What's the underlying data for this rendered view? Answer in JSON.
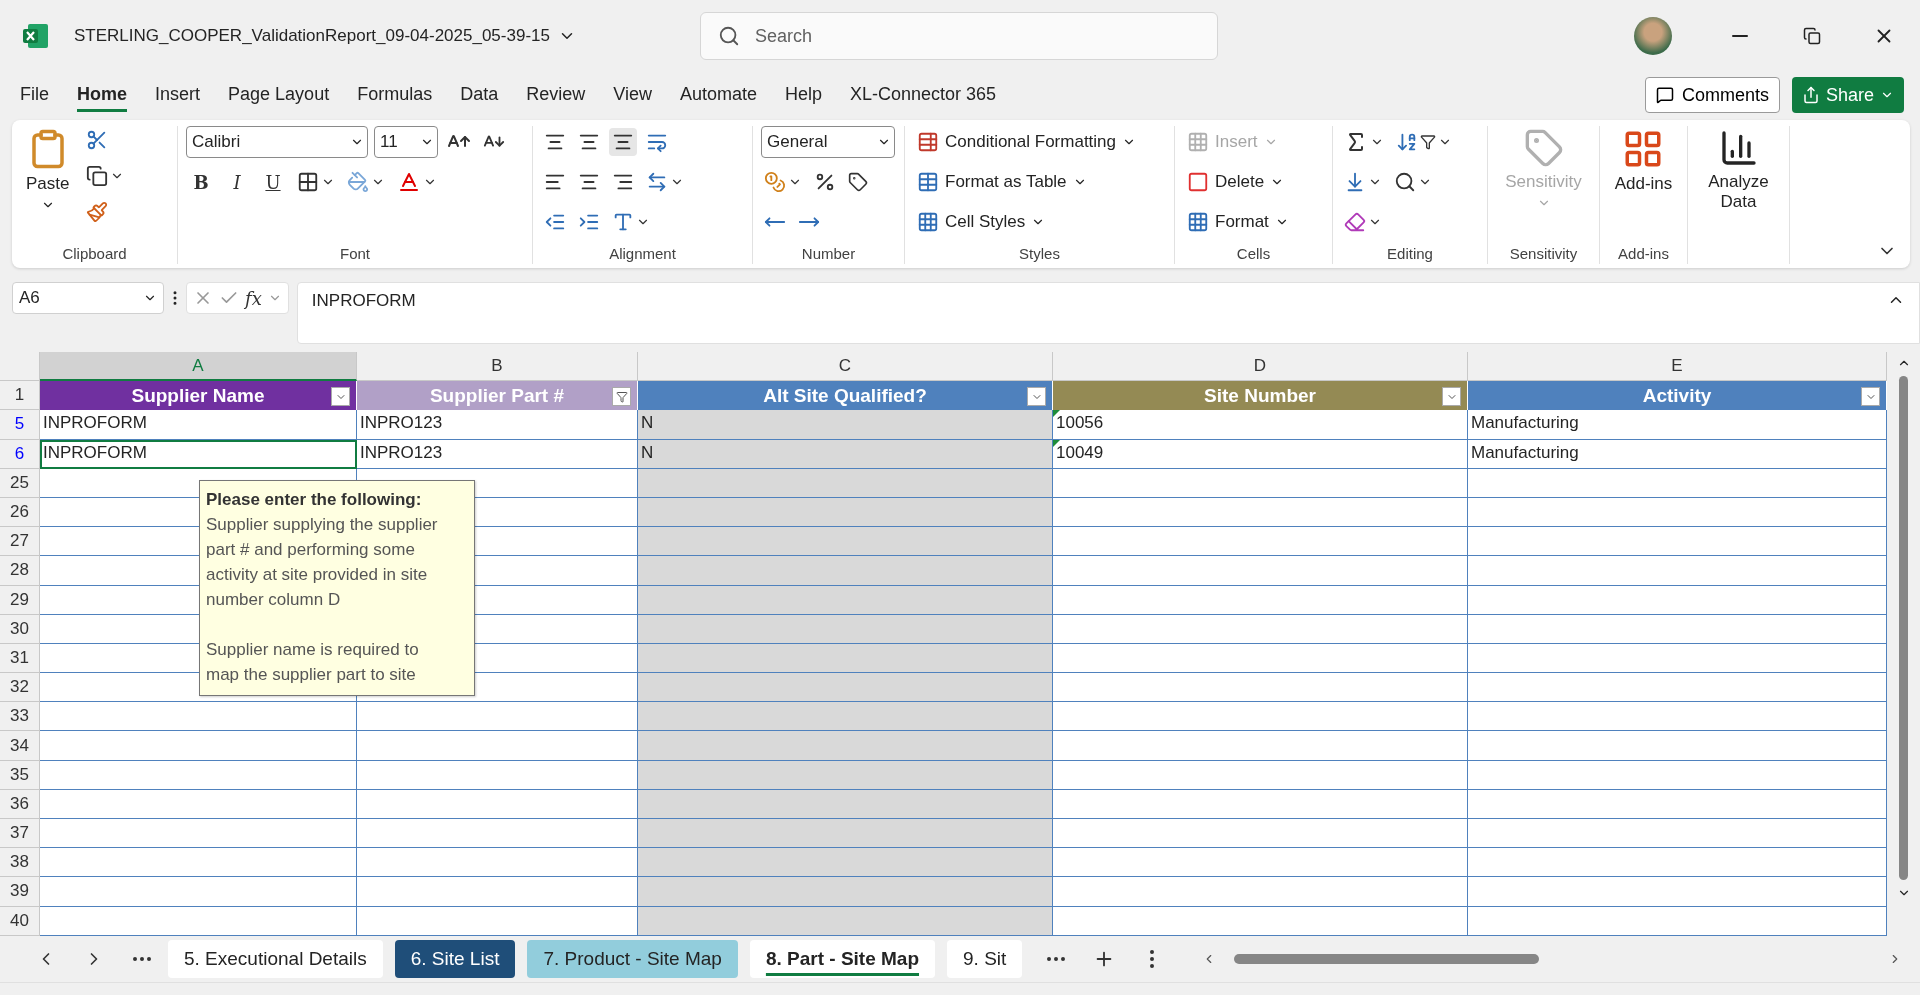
{
  "title_bar": {
    "file_name": "STERLING_COOPER_ValidationReport_09-04-2025_05-39-15",
    "search": {
      "placeholder": "Search"
    }
  },
  "menu_tabs": [
    {
      "label": "File",
      "selected": false
    },
    {
      "label": "Home",
      "selected": true
    },
    {
      "label": "Insert",
      "selected": false
    },
    {
      "label": "Page Layout",
      "selected": false
    },
    {
      "label": "Formulas",
      "selected": false
    },
    {
      "label": "Data",
      "selected": false
    },
    {
      "label": "Review",
      "selected": false
    },
    {
      "label": "View",
      "selected": false
    },
    {
      "label": "Automate",
      "selected": false
    },
    {
      "label": "Help",
      "selected": false
    },
    {
      "label": "XL-Connector 365",
      "selected": false
    }
  ],
  "actions": {
    "comments": "Comments",
    "share": "Share"
  },
  "ribbon": {
    "clipboard": {
      "label": "Clipboard",
      "paste": "Paste"
    },
    "font": {
      "label": "Font",
      "font_name": "Calibri",
      "font_size": "11",
      "bold": "B",
      "italic": "I",
      "underline": "U"
    },
    "alignment": {
      "label": "Alignment"
    },
    "number": {
      "label": "Number",
      "format": "General"
    },
    "styles": {
      "label": "Styles",
      "items": [
        "Conditional Formatting",
        "Format as Table",
        "Cell Styles"
      ]
    },
    "cells": {
      "label": "Cells",
      "items": [
        {
          "label": "Insert",
          "disabled": true
        },
        {
          "label": "Delete",
          "disabled": false
        },
        {
          "label": "Format",
          "disabled": false
        }
      ]
    },
    "editing": {
      "label": "Editing"
    },
    "sensitivity": {
      "label": "Sensitivity",
      "button": "Sensitivity",
      "disabled": true
    },
    "add_ins": {
      "label": "Add-ins",
      "button": "Add-ins"
    },
    "analyze": {
      "button": "Analyze Data"
    }
  },
  "formula_bar": {
    "name_box": "A6",
    "fx": "fx",
    "formula": "INPROFORM"
  },
  "sheet": {
    "column_letters": [
      {
        "letter": "A",
        "selected": true
      },
      {
        "letter": "B",
        "selected": false
      },
      {
        "letter": "C",
        "selected": false
      },
      {
        "letter": "D",
        "selected": false
      },
      {
        "letter": "E",
        "selected": false
      }
    ],
    "columns": [
      {
        "header": "Supplier Name",
        "color": "#7030a0",
        "filtered": false,
        "shaded": false
      },
      {
        "header": "Supplier Part #",
        "color": "#b1a0c7",
        "filtered": true,
        "shaded": false
      },
      {
        "header": "Alt Site Qualified?",
        "color": "#4f81bd",
        "filtered": false,
        "shaded": true
      },
      {
        "header": "Site Number",
        "color": "#948a54",
        "filtered": false,
        "shaded": false
      },
      {
        "header": "Activity",
        "color": "#4f81bd",
        "filtered": false,
        "shaded": false
      }
    ],
    "header_row": "1",
    "rows": [
      {
        "number": "5",
        "filtered": true,
        "cells": [
          {
            "text": "INPROFORM",
            "selected": false,
            "flag": false
          },
          {
            "text": "INPRO123",
            "selected": false,
            "flag": false
          },
          {
            "text": "N",
            "selected": false,
            "flag": false
          },
          {
            "text": "10056",
            "selected": false,
            "flag": true
          },
          {
            "text": "Manufacturing",
            "selected": false,
            "flag": false
          }
        ]
      },
      {
        "number": "6",
        "filtered": true,
        "cells": [
          {
            "text": "INPROFORM",
            "selected": true,
            "flag": false
          },
          {
            "text": "INPRO123",
            "selected": false,
            "flag": false
          },
          {
            "text": "N",
            "selected": false,
            "flag": false
          },
          {
            "text": "10049",
            "selected": false,
            "flag": true
          },
          {
            "text": "Manufacturing",
            "selected": false,
            "flag": false
          }
        ]
      },
      {
        "number": "25",
        "filtered": false
      },
      {
        "number": "26",
        "filtered": false
      },
      {
        "number": "27",
        "filtered": false
      },
      {
        "number": "28",
        "filtered": false
      },
      {
        "number": "29",
        "filtered": false
      },
      {
        "number": "30",
        "filtered": false
      },
      {
        "number": "31",
        "filtered": false
      },
      {
        "number": "32",
        "filtered": false
      },
      {
        "number": "33",
        "filtered": false
      },
      {
        "number": "34",
        "filtered": false
      },
      {
        "number": "35",
        "filtered": false
      },
      {
        "number": "36",
        "filtered": false
      },
      {
        "number": "37",
        "filtered": false
      },
      {
        "number": "38",
        "filtered": false
      },
      {
        "number": "39",
        "filtered": false
      },
      {
        "number": "40",
        "filtered": false
      }
    ],
    "tooltip": {
      "title": "Please enter the following:",
      "paragraphs": [
        "Supplier supplying the supplier part # and performing some activity at site provided in site number column D",
        "Supplier name is required to map the supplier part to site"
      ]
    }
  },
  "sheet_tabs": [
    {
      "label": "5. Executional Details",
      "color": "#ffffff",
      "selected": false
    },
    {
      "label": "6. Site List",
      "color": "#1f4e79",
      "selected": false
    },
    {
      "label": "7. Product - Site Map",
      "color": "#92cddc",
      "selected": false
    },
    {
      "label": "8. Part - Site Map",
      "color": "#ffffff",
      "selected": true
    },
    {
      "label": "9. Sit",
      "color": "#ffffff",
      "selected": false
    }
  ]
}
